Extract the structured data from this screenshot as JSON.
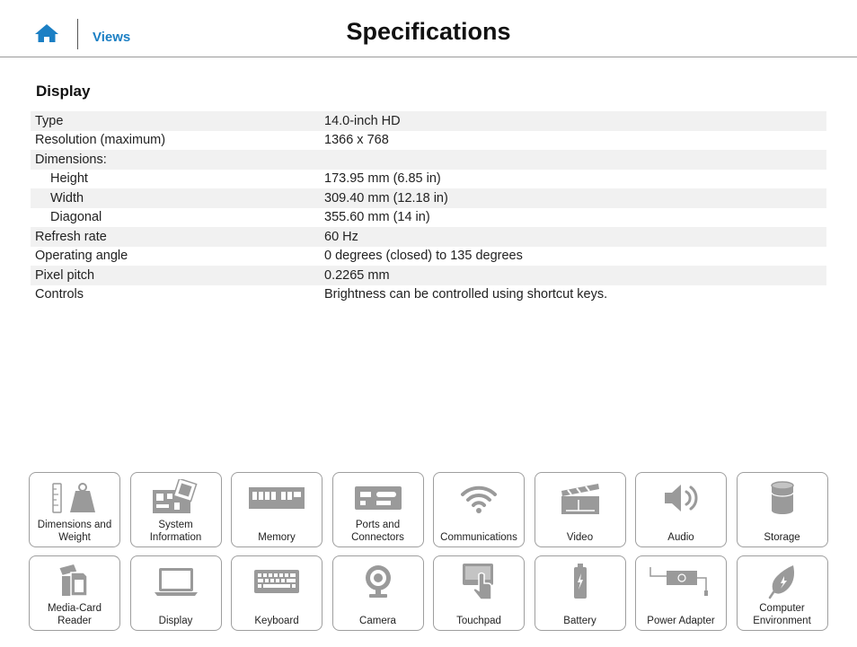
{
  "header": {
    "home_icon": "home-icon",
    "views_label": "Views",
    "title": "Specifications"
  },
  "section": {
    "title": "Display"
  },
  "specs": [
    {
      "label": "Type",
      "value": "14.0-inch HD"
    },
    {
      "label": "Resolution (maximum)",
      "value": "1366 x 768"
    },
    {
      "label": "Dimensions:",
      "value": ""
    },
    {
      "label": "Height",
      "value": "173.95 mm (6.85 in)"
    },
    {
      "label": "Width",
      "value": "309.40 mm (12.18 in)"
    },
    {
      "label": "Diagonal",
      "value": "355.60 mm (14 in)"
    },
    {
      "label": "Refresh rate",
      "value": "60 Hz"
    },
    {
      "label": "Operating angle",
      "value": "0 degrees (closed) to 135 degrees"
    },
    {
      "label": "Pixel pitch",
      "value": "0.2265 mm"
    },
    {
      "label": "Controls",
      "value": "Brightness can be controlled using shortcut keys."
    }
  ],
  "tiles": [
    {
      "label": "Dimensions and Weight",
      "icon": "ruler-weight-icon"
    },
    {
      "label": "System Information",
      "icon": "motherboard-icon"
    },
    {
      "label": "Memory",
      "icon": "memory-module-icon"
    },
    {
      "label": "Ports and Connectors",
      "icon": "ports-icon"
    },
    {
      "label": "Communications",
      "icon": "wifi-icon"
    },
    {
      "label": "Video",
      "icon": "clapperboard-icon"
    },
    {
      "label": "Audio",
      "icon": "speaker-icon"
    },
    {
      "label": "Storage",
      "icon": "storage-cylinder-icon"
    },
    {
      "label": "Media-Card Reader",
      "icon": "sd-card-icon"
    },
    {
      "label": "Display",
      "icon": "laptop-icon"
    },
    {
      "label": "Keyboard",
      "icon": "keyboard-icon"
    },
    {
      "label": "Camera",
      "icon": "webcam-icon"
    },
    {
      "label": "Touchpad",
      "icon": "touchpad-icon"
    },
    {
      "label": "Battery",
      "icon": "battery-icon"
    },
    {
      "label": "Power Adapter",
      "icon": "power-adapter-icon"
    },
    {
      "label": "Computer Environment",
      "icon": "leaf-icon"
    }
  ],
  "colors": {
    "accent": "#1b7fc4",
    "icon_gray": "#9a9a9a",
    "row_shade": "#f1f1f1"
  }
}
